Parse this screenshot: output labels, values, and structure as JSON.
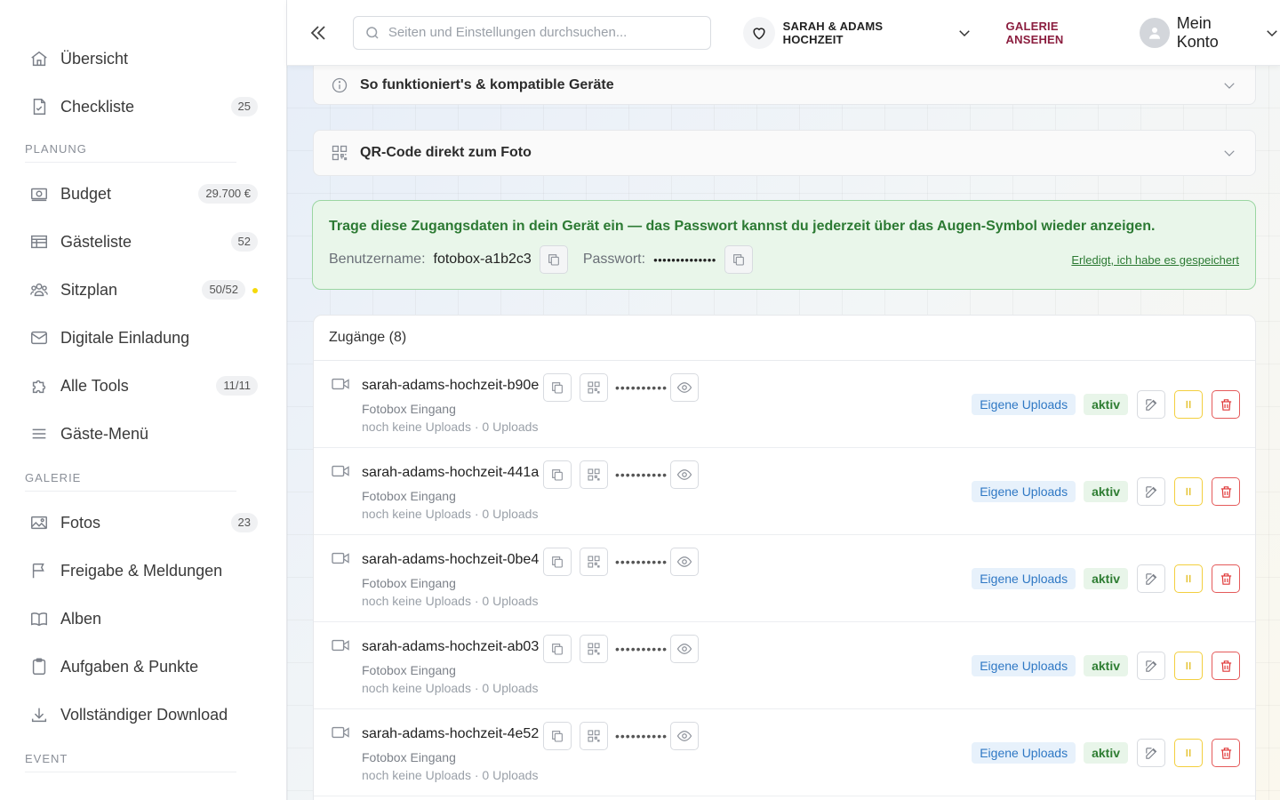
{
  "sidebar": {
    "items_top": [
      {
        "label": "Übersicht",
        "icon": "home-icon",
        "badge": ""
      },
      {
        "label": "Checkliste",
        "icon": "checklist-icon",
        "badge": "25"
      }
    ],
    "planung_title": "PLANUNG",
    "planung": [
      {
        "label": "Budget",
        "icon": "money-icon",
        "badge": "29.700 €"
      },
      {
        "label": "Gästeliste",
        "icon": "table-icon",
        "badge": "52"
      },
      {
        "label": "Sitzplan",
        "icon": "users-icon",
        "badge": "50/52"
      },
      {
        "label": "Digitale Einladung",
        "icon": "mail-icon",
        "badge": ""
      },
      {
        "label": "Alle Tools",
        "icon": "puzzle-icon",
        "badge": "11/11"
      },
      {
        "label": "Gäste-Menü",
        "icon": "menu-icon",
        "badge": ""
      }
    ],
    "galerie_title": "GALERIE",
    "galerie": [
      {
        "label": "Fotos",
        "icon": "image-icon",
        "badge": "23"
      },
      {
        "label": "Freigabe & Meldungen",
        "icon": "flag-icon",
        "badge": ""
      },
      {
        "label": "Alben",
        "icon": "book-icon",
        "badge": ""
      },
      {
        "label": "Aufgaben & Punkte",
        "icon": "clipboard-icon",
        "badge": ""
      },
      {
        "label": "Vollständiger Download",
        "icon": "download-icon",
        "badge": ""
      }
    ],
    "event_title": "EVENT"
  },
  "topbar": {
    "search_placeholder": "Seiten und Einstellungen durchsuchen...",
    "wedding_name": "SARAH & ADAMS HOCHZEIT",
    "gallery_link": "GALERIE ANSEHEN",
    "account_label": "Mein Konto"
  },
  "main": {
    "acc_how": "So funktioniert's & kompatible Geräte",
    "acc_qr": "QR-Code direkt zum Foto",
    "notice": {
      "text": "Trage diese Zugangsdaten in dein Gerät ein — das Passwort kannst du jederzeit über das Augen-Symbol wieder anzeigen.",
      "user_label": "Benutzername:",
      "user_value": "fotobox-a1b2c3",
      "pass_label": "Passwort:",
      "pass_value": "••••••••••••••",
      "done_link": "Erledigt, ich habe es gespeichert"
    },
    "access_title": "Zugänge (8)",
    "accesses": [
      {
        "name": "sarah-adams-hochzeit-b90e",
        "password": "••••••••••",
        "location": "Fotobox Eingang",
        "uploads": "noch keine Uploads · 0 Uploads",
        "tag": "Eigene Uploads",
        "status": "aktiv"
      },
      {
        "name": "sarah-adams-hochzeit-441a",
        "password": "••••••••••",
        "location": "Fotobox Eingang",
        "uploads": "noch keine Uploads · 0 Uploads",
        "tag": "Eigene Uploads",
        "status": "aktiv"
      },
      {
        "name": "sarah-adams-hochzeit-0be4",
        "password": "••••••••••",
        "location": "Fotobox Eingang",
        "uploads": "noch keine Uploads · 0 Uploads",
        "tag": "Eigene Uploads",
        "status": "aktiv"
      },
      {
        "name": "sarah-adams-hochzeit-ab03",
        "password": "••••••••••",
        "location": "Fotobox Eingang",
        "uploads": "noch keine Uploads · 0 Uploads",
        "tag": "Eigene Uploads",
        "status": "aktiv"
      },
      {
        "name": "sarah-adams-hochzeit-4e52",
        "password": "••••••••••",
        "location": "Fotobox Eingang",
        "uploads": "noch keine Uploads · 0 Uploads",
        "tag": "Eigene Uploads",
        "status": "aktiv"
      }
    ]
  },
  "colors": {
    "accent": "#8b1e3f",
    "success": "#2c7a33",
    "warning": "#e0b300",
    "danger": "#e03a3a",
    "info": "#2f78c4"
  }
}
